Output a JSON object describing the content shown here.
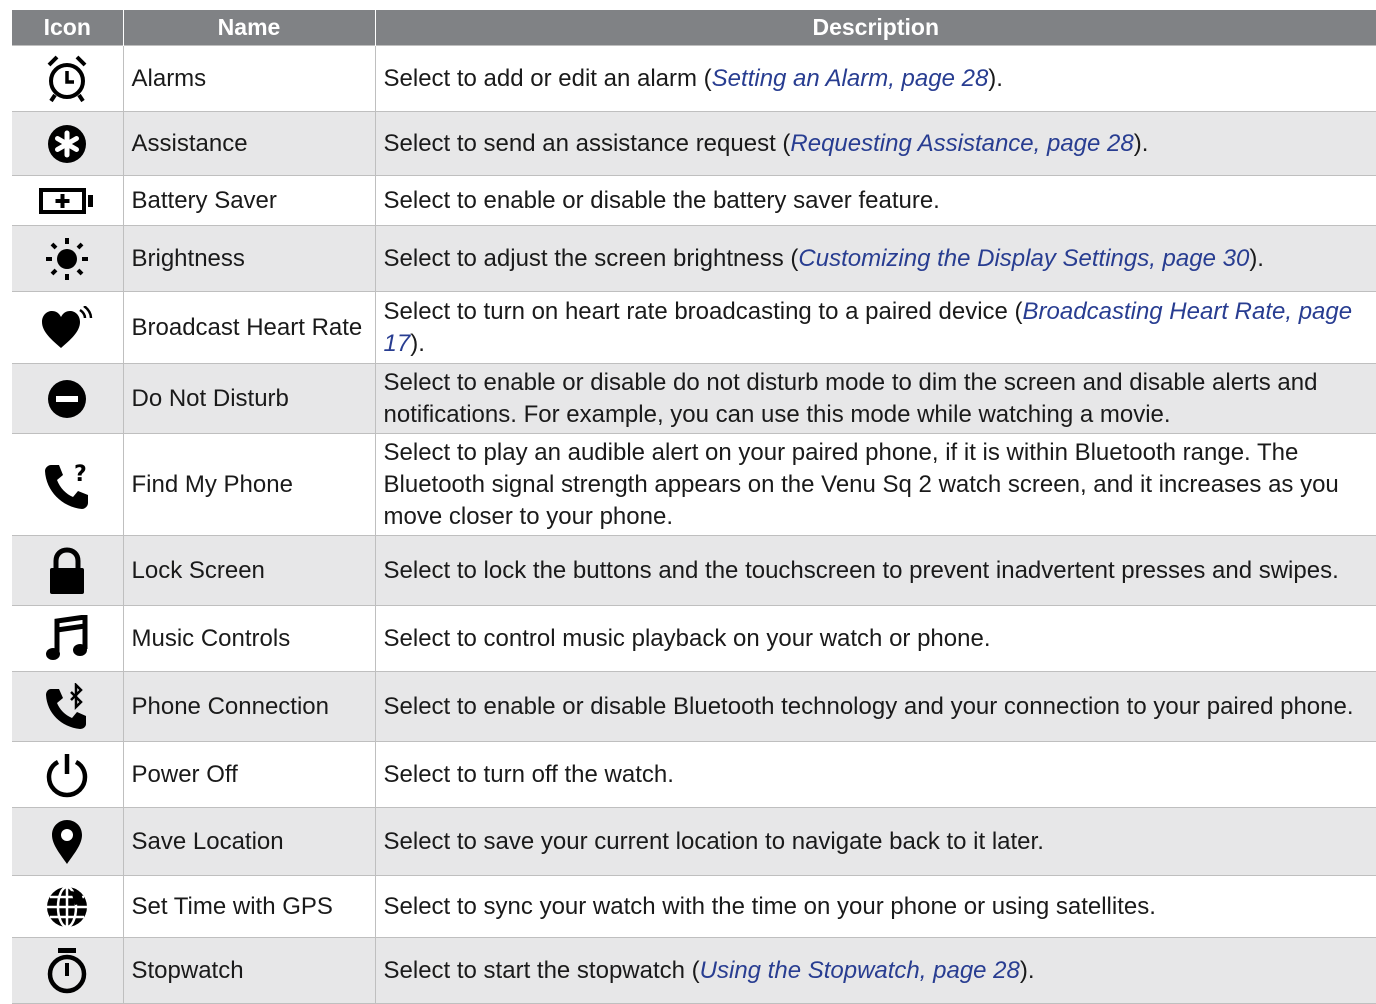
{
  "headers": {
    "icon": "Icon",
    "name": "Name",
    "description": "Description"
  },
  "rows": [
    {
      "icon": "alarm-clock-icon",
      "name": "Alarms",
      "desc_before": "Select to add or edit an alarm (",
      "link": "Setting an Alarm, page 28",
      "desc_after": ")."
    },
    {
      "icon": "assistance-icon",
      "name": "Assistance",
      "desc_before": "Select to send an assistance request (",
      "link": "Requesting Assistance, page 28",
      "desc_after": ")."
    },
    {
      "icon": "battery-saver-icon",
      "name": "Battery Saver",
      "desc_before": "Select to enable or disable the battery saver feature.",
      "link": "",
      "desc_after": ""
    },
    {
      "icon": "brightness-icon",
      "name": "Brightness",
      "desc_before": "Select to adjust the screen brightness (",
      "link": "Customizing the Display Settings, page 30",
      "desc_after": ")."
    },
    {
      "icon": "broadcast-heart-icon",
      "name": "Broadcast Heart Rate",
      "desc_before": "Select to turn on heart rate broadcasting to a paired device (",
      "link": "Broadcasting Heart Rate, page 17",
      "desc_after": ")."
    },
    {
      "icon": "do-not-disturb-icon",
      "name": "Do Not Disturb",
      "desc_before": "Select to enable or disable do not disturb mode to dim the screen and disable alerts and notifications. For example, you can use this mode while watching a movie.",
      "link": "",
      "desc_after": ""
    },
    {
      "icon": "find-phone-icon",
      "name": "Find My Phone",
      "desc_before": "Select to play an audible alert on your paired phone, if it is within Bluetooth range. The Bluetooth signal strength appears on the Venu Sq 2 watch screen, and it increases as you move closer to your phone.",
      "link": "",
      "desc_after": ""
    },
    {
      "icon": "lock-icon",
      "name": "Lock Screen",
      "desc_before": "Select to lock the buttons and the touchscreen to prevent inadvertent presses and swipes.",
      "link": "",
      "desc_after": ""
    },
    {
      "icon": "music-note-icon",
      "name": "Music Controls",
      "desc_before": "Select to control music playback on your watch or phone.",
      "link": "",
      "desc_after": ""
    },
    {
      "icon": "phone-bluetooth-icon",
      "name": "Phone Connection",
      "desc_before": "Select to enable or disable Bluetooth technology and your connection to your paired phone.",
      "link": "",
      "desc_after": ""
    },
    {
      "icon": "power-icon",
      "name": "Power Off",
      "desc_before": "Select to turn off the watch.",
      "link": "",
      "desc_after": ""
    },
    {
      "icon": "location-pin-icon",
      "name": "Save Location",
      "desc_before": "Select to save your current location to navigate back to it later.",
      "link": "",
      "desc_after": ""
    },
    {
      "icon": "globe-gps-icon",
      "name": "Set Time with GPS",
      "desc_before": "Select to sync your watch with the time on your phone or using satellites.",
      "link": "",
      "desc_after": ""
    },
    {
      "icon": "stopwatch-icon",
      "name": "Stopwatch",
      "desc_before": "Select to start the stopwatch (",
      "link": "Using the Stopwatch, page 28",
      "desc_after": ")."
    }
  ],
  "colors": {
    "header_bg": "#808285",
    "header_text": "#ffffff",
    "row_alt_bg": "#e7e7e8",
    "link": "#283d91",
    "border": "#bfbfbf"
  }
}
